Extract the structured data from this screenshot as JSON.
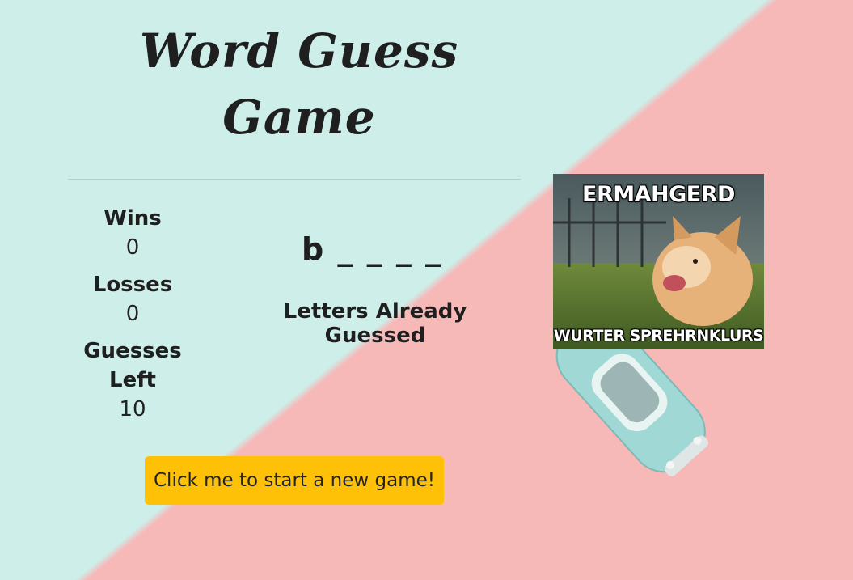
{
  "header": {
    "title_line1": "Word Guess",
    "title_line2": "Game"
  },
  "stats": {
    "wins_label": "Wins",
    "wins_value": "0",
    "losses_label": "Losses",
    "losses_value": "0",
    "guesses_label_line1": "Guesses",
    "guesses_label_line2": "Left",
    "guesses_value": "10"
  },
  "game": {
    "word_display": "b _ _ _ _",
    "guessed_label": "Letters Already Guessed",
    "new_game_button": "Click me to start a new game!"
  },
  "meme": {
    "top_text": "ERMAHGERD",
    "bottom_text": "WURTER SPREHRNKLURS"
  },
  "colors": {
    "background_left": "#cdeee9",
    "background_right": "#f7b8b8",
    "button": "#ffc107",
    "car": "#9fd8d4"
  }
}
